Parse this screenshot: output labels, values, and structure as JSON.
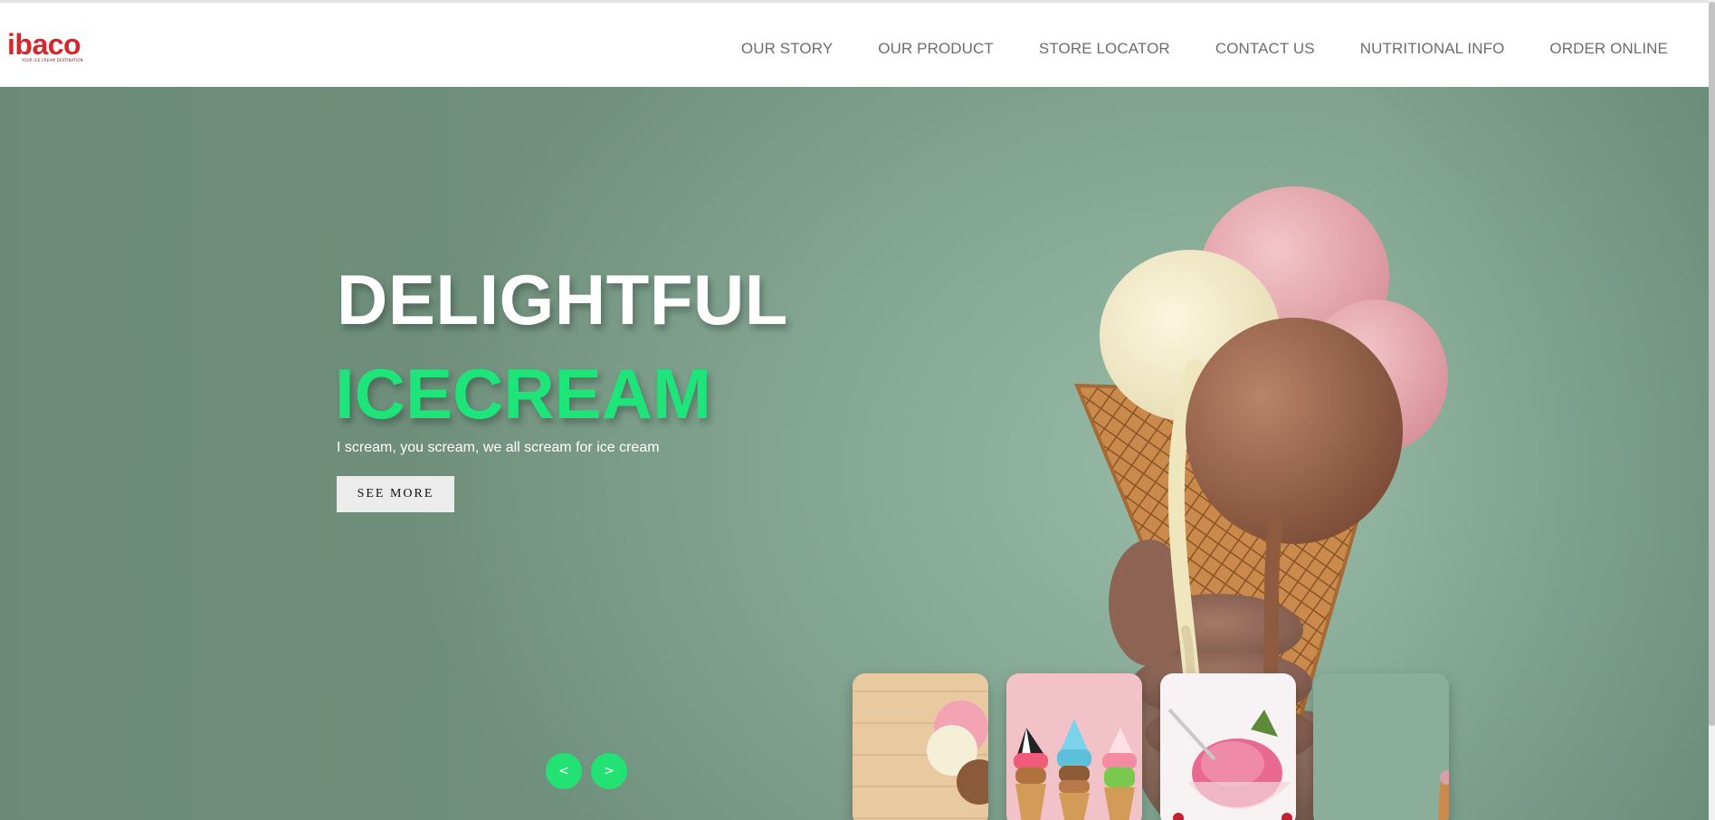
{
  "brand": {
    "logo_text": "ibaco",
    "logo_tagline": "YOUR ICE CREAM DESTINATION",
    "color": "#d8262d"
  },
  "nav": {
    "items": [
      {
        "label": "OUR STORY"
      },
      {
        "label": "OUR PRODUCT"
      },
      {
        "label": "STORE LOCATOR"
      },
      {
        "label": "CONTACT US"
      },
      {
        "label": "NUTRITIONAL INFO"
      },
      {
        "label": "ORDER ONLINE"
      }
    ]
  },
  "hero": {
    "title": "DELIGHTFUL",
    "subtitle": "ICECREAM",
    "tagline": "I scream, you scream, we all scream for ice cream",
    "cta_label": "SEE MORE",
    "prev_label": "<",
    "next_label": ">",
    "accent_color": "#22e273",
    "background_color": "#86a996"
  },
  "thumbnails": [
    {
      "name": "scoops-on-wood"
    },
    {
      "name": "colorful-cones"
    },
    {
      "name": "pink-ice-cream-bowl"
    },
    {
      "name": "ice-cream-cone-green"
    }
  ]
}
